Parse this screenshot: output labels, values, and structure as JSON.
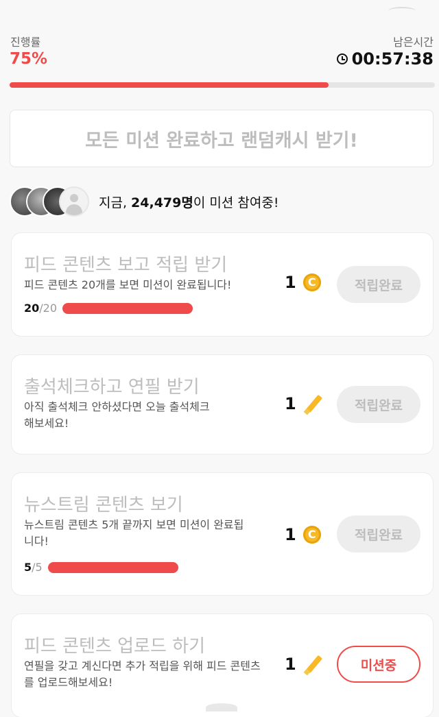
{
  "header": {
    "progress_label": "진행률",
    "progress_value": "75%",
    "progress_fraction": 0.75,
    "time_label": "남은시간",
    "time_value": "00:57:38",
    "accent_color": "#f04b4b"
  },
  "banner": {
    "text": "모든 미션 완료하고 랜덤캐시 받기!"
  },
  "participants": {
    "prefix": "지금, ",
    "count": "24,479명",
    "suffix": "이 미션 참여중!"
  },
  "missions": [
    {
      "title": "피드 콘텐츠 보고 적립 받기",
      "desc": "피드 콘텐츠 20개를 보면 미션이 완료됩니다!",
      "progress_done": "20",
      "progress_total": "/20",
      "reward_amount": "1",
      "reward_icon": "coin-icon",
      "button_label": "적립완료",
      "status": "done"
    },
    {
      "title": "출석체크하고 연필 받기",
      "desc": "아직 출석체크 안하셨다면 오늘 출석체크해보세요!",
      "reward_amount": "1",
      "reward_icon": "pencil-icon",
      "button_label": "적립완료",
      "status": "done"
    },
    {
      "title": "뉴스트림 콘텐츠 보기",
      "desc": "뉴스트림 콘텐츠 5개 끝까지 보면 미션이 완료됩니다!",
      "progress_done": "5",
      "progress_total": "/5",
      "reward_amount": "1",
      "reward_icon": "coin-icon",
      "button_label": "적립완료",
      "status": "done"
    },
    {
      "title": "피드 콘텐츠 업로드 하기",
      "desc": "연필을 갖고 계신다면 추가 적립을 위해 피드 콘텐츠를 업로드해보세요!",
      "reward_amount": "1",
      "reward_icon": "pencil-icon",
      "button_label": "미션중",
      "status": "active"
    }
  ]
}
